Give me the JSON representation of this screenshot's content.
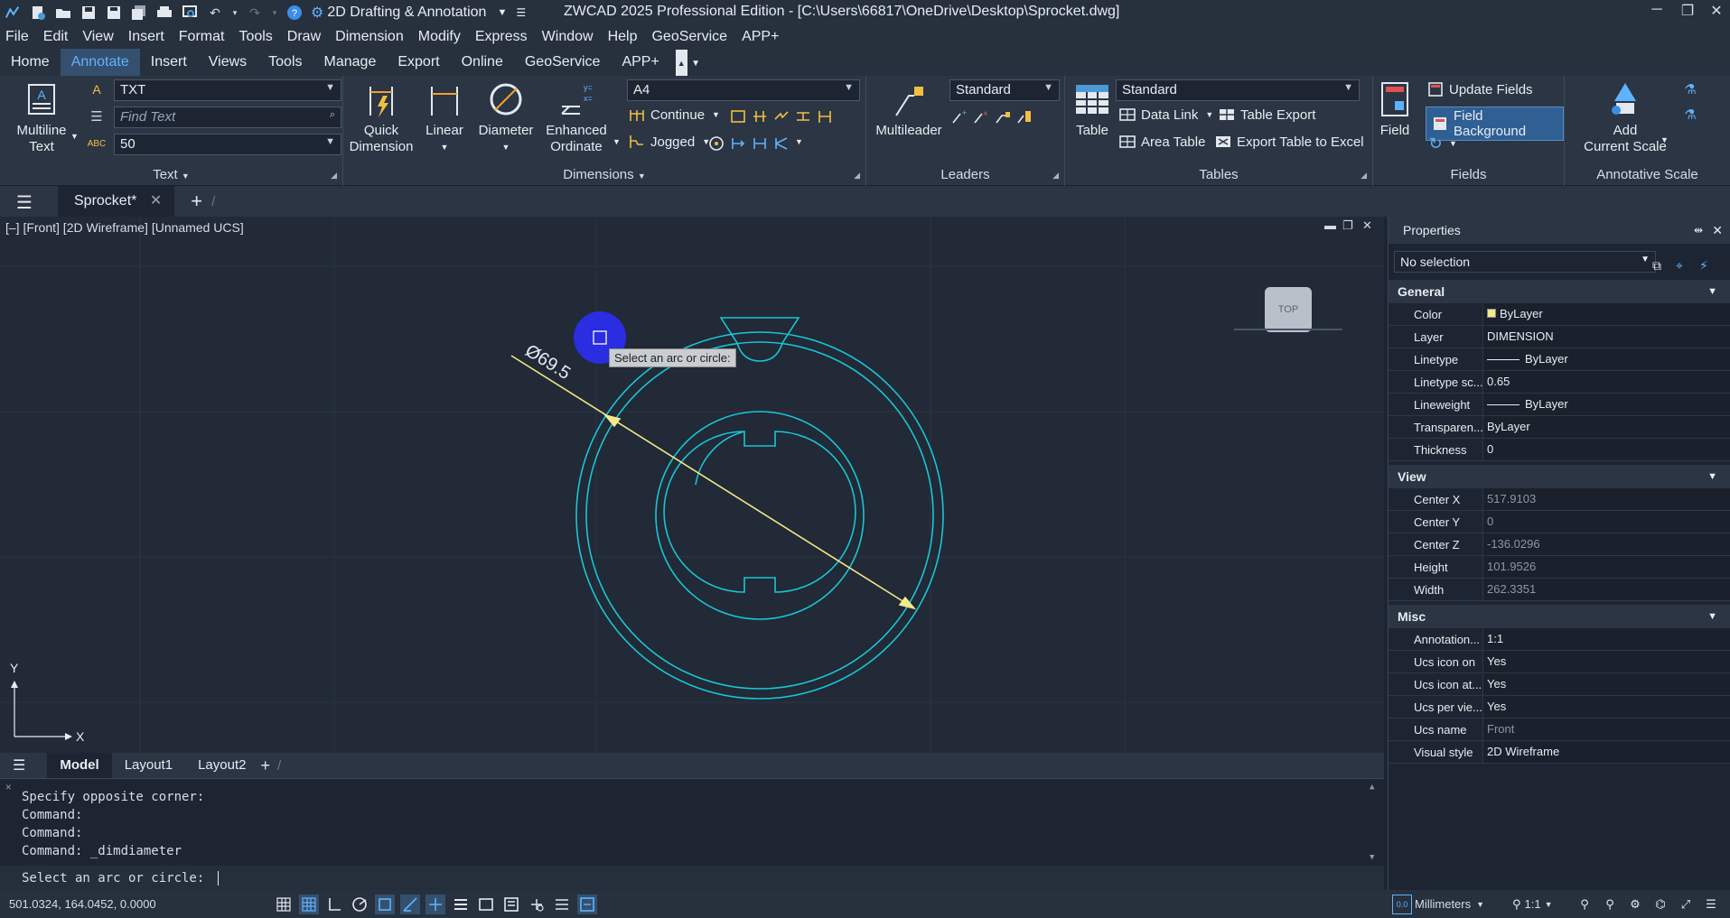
{
  "app": {
    "window_title": "ZWCAD 2025 Professional Edition - [C:\\Users\\66817\\OneDrive\\Desktop\\Sprocket.dwg]",
    "workspace": "2D Drafting & Annotation"
  },
  "menu": [
    "File",
    "Edit",
    "View",
    "Insert",
    "Format",
    "Tools",
    "Draw",
    "Dimension",
    "Modify",
    "Express",
    "Window",
    "Help",
    "GeoService",
    "APP+"
  ],
  "ribbon_tabs": [
    "Home",
    "Annotate",
    "Insert",
    "Views",
    "Tools",
    "Manage",
    "Export",
    "Online",
    "GeoService",
    "APP+"
  ],
  "ribbon": {
    "text": {
      "multiline_text": "Multiline\nText",
      "style_value": "TXT",
      "find_placeholder": "Find Text",
      "height_value": "50",
      "title": "Text"
    },
    "dimensions": {
      "quick": "Quick\nDimension",
      "linear": "Linear",
      "diameter": "Diameter",
      "enhanced": "Enhanced\nOrdinate",
      "style_value": "A4",
      "continue": "Continue",
      "jogged": "Jogged",
      "title": "Dimensions"
    },
    "leaders": {
      "multileader": "Multileader",
      "style_value": "Standard",
      "title": "Leaders"
    },
    "tables": {
      "table": "Table",
      "style_value": "Standard",
      "data_link": "Data Link",
      "table_export": "Table Export",
      "area_table": "Area Table",
      "export_excel": "Export Table to Excel",
      "title": "Tables"
    },
    "fields": {
      "field": "Field",
      "update_fields": "Update Fields",
      "field_background": "Field Background",
      "title": "Fields"
    },
    "annotative": {
      "add_scale": "Add\nCurrent Scale",
      "title": "Annotative Scale"
    }
  },
  "doc_tab": "Sprocket*",
  "viewport": {
    "label": "[–] [Front] [2D Wireframe] [Unnamed UCS]",
    "viewcube": "TOP",
    "tooltip": "Select an arc or circle:",
    "dim_text": "Ø69.5",
    "ucs_y": "Y",
    "ucs_x": "X"
  },
  "layout_tabs": [
    "Model",
    "Layout1",
    "Layout2"
  ],
  "command": {
    "history": [
      "Specify opposite corner:",
      "Command:",
      "Command:",
      "Command: _dimdiameter"
    ],
    "prompt": "Select an arc or circle:"
  },
  "properties": {
    "title": "Properties",
    "selection": "No selection",
    "sections": [
      {
        "name": "General",
        "rows": [
          {
            "key": "Color",
            "value": "ByLayer",
            "swatch": "#f3e98a"
          },
          {
            "key": "Layer",
            "value": "DIMENSION"
          },
          {
            "key": "Linetype",
            "value": "ByLayer",
            "line": true
          },
          {
            "key": "Linetype sc...",
            "value": "0.65"
          },
          {
            "key": "Lineweight",
            "value": "ByLayer",
            "line": true
          },
          {
            "key": "Transparen...",
            "value": "ByLayer"
          },
          {
            "key": "Thickness",
            "value": "0"
          }
        ]
      },
      {
        "name": "View",
        "rows": [
          {
            "key": "Center X",
            "value": "517.9103",
            "ro": true
          },
          {
            "key": "Center Y",
            "value": "0",
            "ro": true
          },
          {
            "key": "Center Z",
            "value": "-136.0296",
            "ro": true
          },
          {
            "key": "Height",
            "value": "101.9526",
            "ro": true
          },
          {
            "key": "Width",
            "value": "262.3351",
            "ro": true
          }
        ]
      },
      {
        "name": "Misc",
        "rows": [
          {
            "key": "Annotation...",
            "value": "1:1"
          },
          {
            "key": "Ucs icon on",
            "value": "Yes"
          },
          {
            "key": "Ucs icon at...",
            "value": "Yes"
          },
          {
            "key": "Ucs per vie...",
            "value": "Yes"
          },
          {
            "key": "Ucs name",
            "value": "Front",
            "ro": true
          },
          {
            "key": "Visual style",
            "value": "2D Wireframe"
          }
        ]
      }
    ]
  },
  "status": {
    "coords": "501.0324, 164.0452, 0.0000",
    "units": "Millimeters",
    "scale": "1:1"
  },
  "colors": {
    "accent": "#5eb3ff",
    "geometry": "#19c5d6",
    "dimension": "#f3e98a",
    "pickbox": "#2a2de0"
  }
}
